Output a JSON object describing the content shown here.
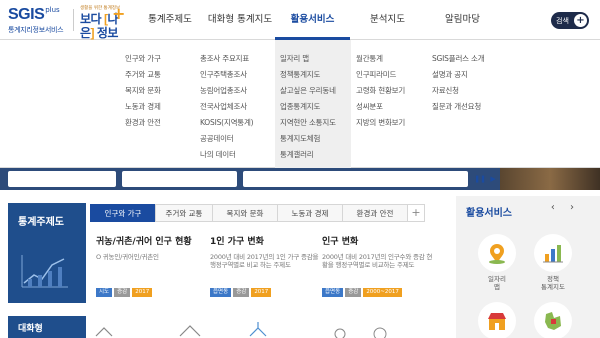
{
  "header": {
    "logo_main": "SGIS",
    "logo_plus": "plus",
    "logo_sub": "통계지리정보서비스",
    "badge_small": "생활을 위한 통계정보",
    "badge_main_a": "보다",
    "badge_main_b": "나은",
    "badge_main_c": "정보",
    "search_label": "검색"
  },
  "nav": [
    {
      "label": "통계주제도"
    },
    {
      "label": "대화형 통계지도"
    },
    {
      "label": "활용서비스"
    },
    {
      "label": "분석지도"
    },
    {
      "label": "알림마당"
    }
  ],
  "mega": {
    "col1": [
      "인구와 가구",
      "주거와 교통",
      "복지와 문화",
      "노동과 경제",
      "환경과 안전"
    ],
    "col2": [
      "총조사 주요지표",
      "인구주택총조사",
      "농림어업총조사",
      "전국사업체조사",
      "KOSIS(지역통계)",
      "공공데이터",
      "나의 데이터"
    ],
    "col3": [
      "일자리 맵",
      "정책통계지도",
      "살고싶은 우리동네",
      "업종통계지도",
      "지역현안 소통지도",
      "통계지도체험",
      "통계갤러리"
    ],
    "col4": [
      "월간통계",
      "인구피라미드",
      "고령화 현황보기",
      "성씨분포",
      "지방의 변화보기"
    ],
    "col5": [
      "SGIS플러스 소개",
      "설명과 공지",
      "자료신청",
      "질문과 개선요청"
    ]
  },
  "stat": {
    "section_title": "통계주제도",
    "tabs": [
      "인구와 가구",
      "주거와 교통",
      "복지와 문화",
      "노동과 경제",
      "환경과 안전"
    ],
    "tab_add": "+",
    "cards": [
      {
        "title": "귀농/귀촌/귀어 인구 현황",
        "desc": "O 귀농인/귀어인/귀촌인",
        "tags": [
          "시도",
          "증감",
          "2017"
        ]
      },
      {
        "title": "1인 가구 변화",
        "desc": "2000년 대비 2017년의 1인 가구 증감을 행정구역별로 비교 하는 주제도",
        "tags": [
          "읍면동",
          "증감",
          "2017"
        ]
      },
      {
        "title": "인구 변화",
        "desc": "2000년 대비 2017년의 인구수와 증감 현황을 행정구역별로 비교하는 주제도",
        "tags": [
          "읍면동",
          "증감",
          "2000~2017"
        ]
      }
    ],
    "bottom_title": "대화형"
  },
  "panel": {
    "title": "활용서비스",
    "arrows": "‹ ›",
    "services": [
      {
        "label": "일자리\n맵",
        "icon": "pin-icon"
      },
      {
        "label": "정책\n통계지도",
        "icon": "bar-chart-icon"
      },
      {
        "label": "",
        "icon": "store-icon"
      },
      {
        "label": "",
        "icon": "map-icon"
      }
    ]
  },
  "colors": {
    "brand": "#1a4ba0",
    "accent": "#f0a020",
    "dark": "#1e2b4a"
  }
}
